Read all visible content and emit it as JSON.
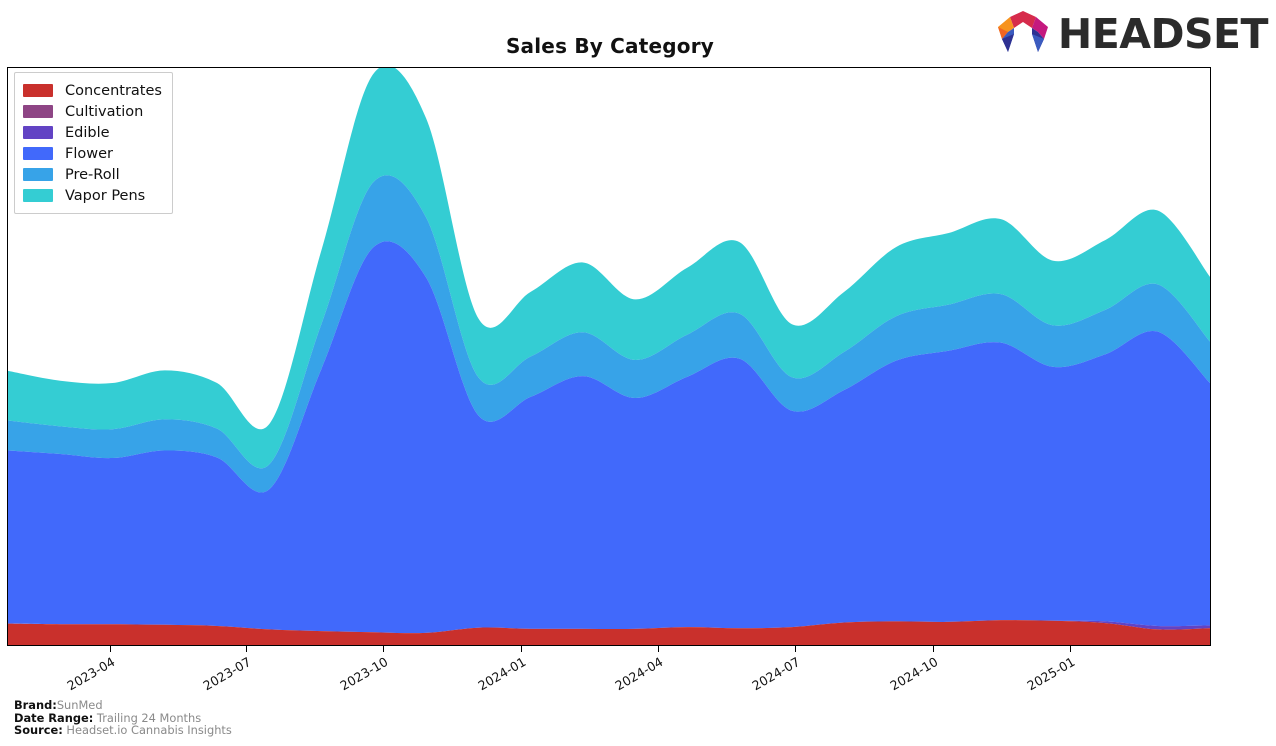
{
  "header": {
    "title": "Sales By Category",
    "logo_word": "HEADSET",
    "logo_icon": "headset-hexagon-logo"
  },
  "legend": {
    "position": "top-left",
    "items": [
      {
        "label": "Concentrates",
        "color": "#c9302c"
      },
      {
        "label": "Cultivation",
        "color": "#8e4585"
      },
      {
        "label": "Edible",
        "color": "#6243c4"
      },
      {
        "label": "Flower",
        "color": "#4169fb"
      },
      {
        "label": "Pre-Roll",
        "color": "#37a3e8"
      },
      {
        "label": "Vapor Pens",
        "color": "#34cdd3"
      }
    ]
  },
  "footer": {
    "brand_label": "Brand:",
    "brand_value": "SunMed",
    "date_range_label": "Date Range:",
    "date_range_value": "Trailing 24 Months",
    "source_label": "Source:",
    "source_value": "Headset.io Cannabis Insights"
  },
  "chart_data": {
    "type": "area",
    "stacked": true,
    "title": "Sales By Category",
    "xlabel": "",
    "ylabel": "",
    "grid": false,
    "legend_position": "top-left",
    "axis": {
      "x_tick_labels": [
        "2023-04",
        "2023-07",
        "2023-10",
        "2024-01",
        "2024-04",
        "2024-07",
        "2024-10",
        "2025-01"
      ],
      "x_tick_positions_pct": [
        8.55,
        19.85,
        31.23,
        42.69,
        54.07,
        65.45,
        76.91,
        88.29
      ],
      "y_tick_labels": [],
      "ylim": [
        0,
        1.0
      ]
    },
    "x": [
      "2023-02",
      "2023-03",
      "2023-04",
      "2023-05",
      "2023-06",
      "2023-07",
      "2023-08",
      "2023-09",
      "2023-10",
      "2023-11",
      "2023-12",
      "2024-01",
      "2024-02",
      "2024-03",
      "2024-04",
      "2024-05",
      "2024-06",
      "2024-07",
      "2024-08",
      "2024-09",
      "2024-10",
      "2024-11",
      "2024-12",
      "2025-01"
    ],
    "series": [
      {
        "name": "Concentrates",
        "color": "#c9302c",
        "values": [
          0.037,
          0.036,
          0.036,
          0.035,
          0.033,
          0.027,
          0.024,
          0.022,
          0.021,
          0.03,
          0.028,
          0.028,
          0.028,
          0.031,
          0.029,
          0.031,
          0.039,
          0.041,
          0.04,
          0.043,
          0.042,
          0.038,
          0.027,
          0.029
        ]
      },
      {
        "name": "Cultivation",
        "color": "#8e4585",
        "values": [
          0.0,
          0.0,
          0.0,
          0.0,
          0.0,
          0.0,
          0.0,
          0.0,
          0.0,
          0.0,
          0.0,
          0.0,
          0.0,
          0.0,
          0.0,
          0.0,
          0.0,
          0.0,
          0.0,
          0.0,
          0.0,
          0.0,
          0.0,
          0.0
        ]
      },
      {
        "name": "Edible",
        "color": "#6243c4",
        "values": [
          0.0,
          0.0,
          0.0,
          0.0,
          0.0,
          0.0,
          0.0,
          0.0,
          0.0,
          0.0,
          0.0,
          0.0,
          0.0,
          0.0,
          0.0,
          0.0,
          0.0,
          0.0,
          0.0,
          0.0,
          0.0,
          0.003,
          0.006,
          0.005
        ]
      },
      {
        "name": "Flower",
        "color": "#4169fb",
        "values": [
          0.3,
          0.295,
          0.288,
          0.302,
          0.292,
          0.243,
          0.455,
          0.668,
          0.616,
          0.368,
          0.402,
          0.438,
          0.4,
          0.434,
          0.467,
          0.375,
          0.403,
          0.452,
          0.47,
          0.481,
          0.44,
          0.463,
          0.51,
          0.42
        ]
      },
      {
        "name": "Pre-Roll",
        "color": "#37a3e8",
        "values": [
          0.052,
          0.048,
          0.05,
          0.054,
          0.05,
          0.043,
          0.078,
          0.113,
          0.104,
          0.066,
          0.07,
          0.076,
          0.066,
          0.073,
          0.078,
          0.058,
          0.066,
          0.077,
          0.08,
          0.084,
          0.072,
          0.077,
          0.082,
          0.072
        ]
      },
      {
        "name": "Vapor Pens",
        "color": "#34cdd3",
        "values": [
          0.086,
          0.079,
          0.08,
          0.085,
          0.079,
          0.07,
          0.128,
          0.188,
          0.172,
          0.102,
          0.112,
          0.121,
          0.105,
          0.116,
          0.124,
          0.092,
          0.104,
          0.12,
          0.124,
          0.13,
          0.112,
          0.121,
          0.128,
          0.112
        ]
      }
    ]
  }
}
